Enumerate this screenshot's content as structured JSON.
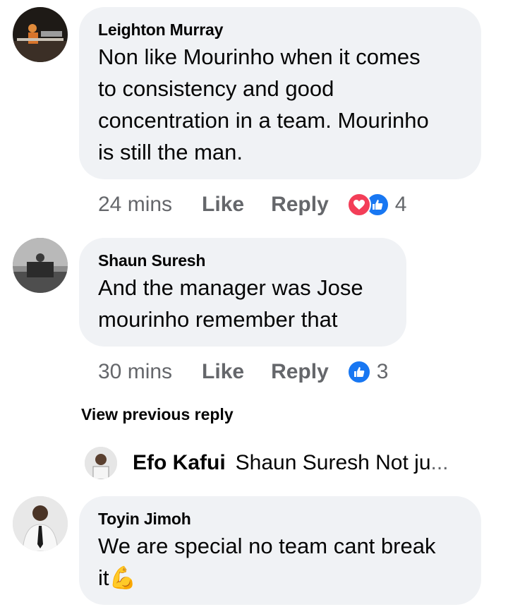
{
  "comments": [
    {
      "author": "Leighton Murray",
      "text_lines": [
        "Non like Mourinho when it comes",
        "to consistency and good",
        "concentration in a team. Mourinho",
        "is still the man."
      ],
      "time": "24 mins",
      "like_label": "Like",
      "reply_label": "Reply",
      "reactions": [
        "love-icon",
        "like-icon"
      ],
      "reaction_count": "4"
    },
    {
      "author": "Shaun Suresh",
      "text_lines": [
        "And the manager was Jose",
        "mourinho remember that"
      ],
      "time": "30 mins",
      "like_label": "Like",
      "reply_label": "Reply",
      "reactions": [
        "like-icon"
      ],
      "reaction_count": "3"
    },
    {
      "author": "Toyin Jimoh",
      "text_lines": [
        "We are special no team cant break",
        "it"
      ],
      "emoji": "💪"
    }
  ],
  "view_previous_reply": "View previous reply",
  "reply_preview": {
    "author": "Efo Kafui",
    "text": "Shaun Suresh Not ju",
    "ellipsis": "..."
  },
  "colors": {
    "bubble": "#f0f2f5",
    "meta": "#65676b",
    "like_blue": "#1877f2",
    "love_red": "#f33e58"
  }
}
